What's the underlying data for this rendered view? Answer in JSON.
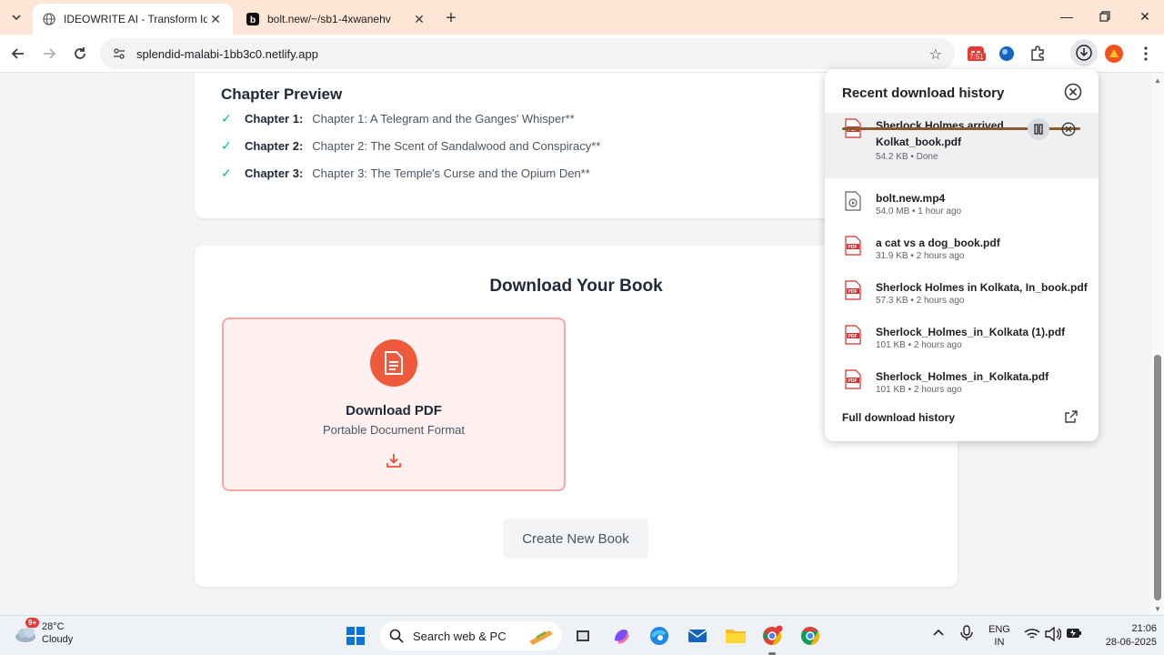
{
  "browser": {
    "tabs": [
      {
        "title": "IDEOWRITE AI - Transform Idea",
        "active": true
      },
      {
        "title": "bolt.new/~/sb1-4xwanehv",
        "active": false
      }
    ],
    "url": "splendid-malabi-1bb3c0.netlify.app",
    "extension_badge": "7:51"
  },
  "preview": {
    "title": "Chapter Preview",
    "chapters": [
      {
        "label": "Chapter 1:",
        "text": "Chapter 1: A Telegram and the Ganges' Whisper**"
      },
      {
        "label": "Chapter 2:",
        "text": "Chapter 2: The Scent of Sandalwood and Conspiracy**"
      },
      {
        "label": "Chapter 3:",
        "text": "Chapter 3: The Temple's Curse and the Opium Den**"
      }
    ]
  },
  "download": {
    "heading": "Download Your Book",
    "pdf_title": "Download PDF",
    "pdf_subtitle": "Portable Document Format",
    "create_new": "Create New Book"
  },
  "downloads_panel": {
    "title": "Recent download history",
    "items": [
      {
        "name": "Sherlock Holmes arrived Kolkat_book.pdf",
        "meta": "54.2 KB • Done",
        "type": "pdf",
        "progress": 1.0
      },
      {
        "name": "bolt.new.mp4",
        "meta": "54.0 MB • 1 hour ago",
        "type": "video"
      },
      {
        "name": "a cat vs a dog_book.pdf",
        "meta": "31.9 KB • 2 hours ago",
        "type": "pdf"
      },
      {
        "name": "Sherlock Holmes in Kolkata, In_book.pdf",
        "meta": "57.3 KB • 2 hours ago",
        "type": "pdf"
      },
      {
        "name": "Sherlock_Holmes_in_Kolkata (1).pdf",
        "meta": "101 KB • 2 hours ago",
        "type": "pdf"
      },
      {
        "name": "Sherlock_Holmes_in_Kolkata.pdf",
        "meta": "101 KB • 2 hours ago",
        "type": "pdf"
      }
    ],
    "full_history": "Full download history"
  },
  "taskbar": {
    "weather_temp": "28°C",
    "weather_desc": "Cloudy",
    "weather_badge": "9+",
    "search_placeholder": "Search web & PC",
    "lang_line1": "ENG",
    "lang_line2": "IN",
    "time": "21:06",
    "date": "28-06-2025"
  },
  "colors": {
    "tabstrip": "#fde6d6",
    "accent_pdf": "#f05a3c",
    "check": "#10b981",
    "progress": "#8b5a2b"
  }
}
